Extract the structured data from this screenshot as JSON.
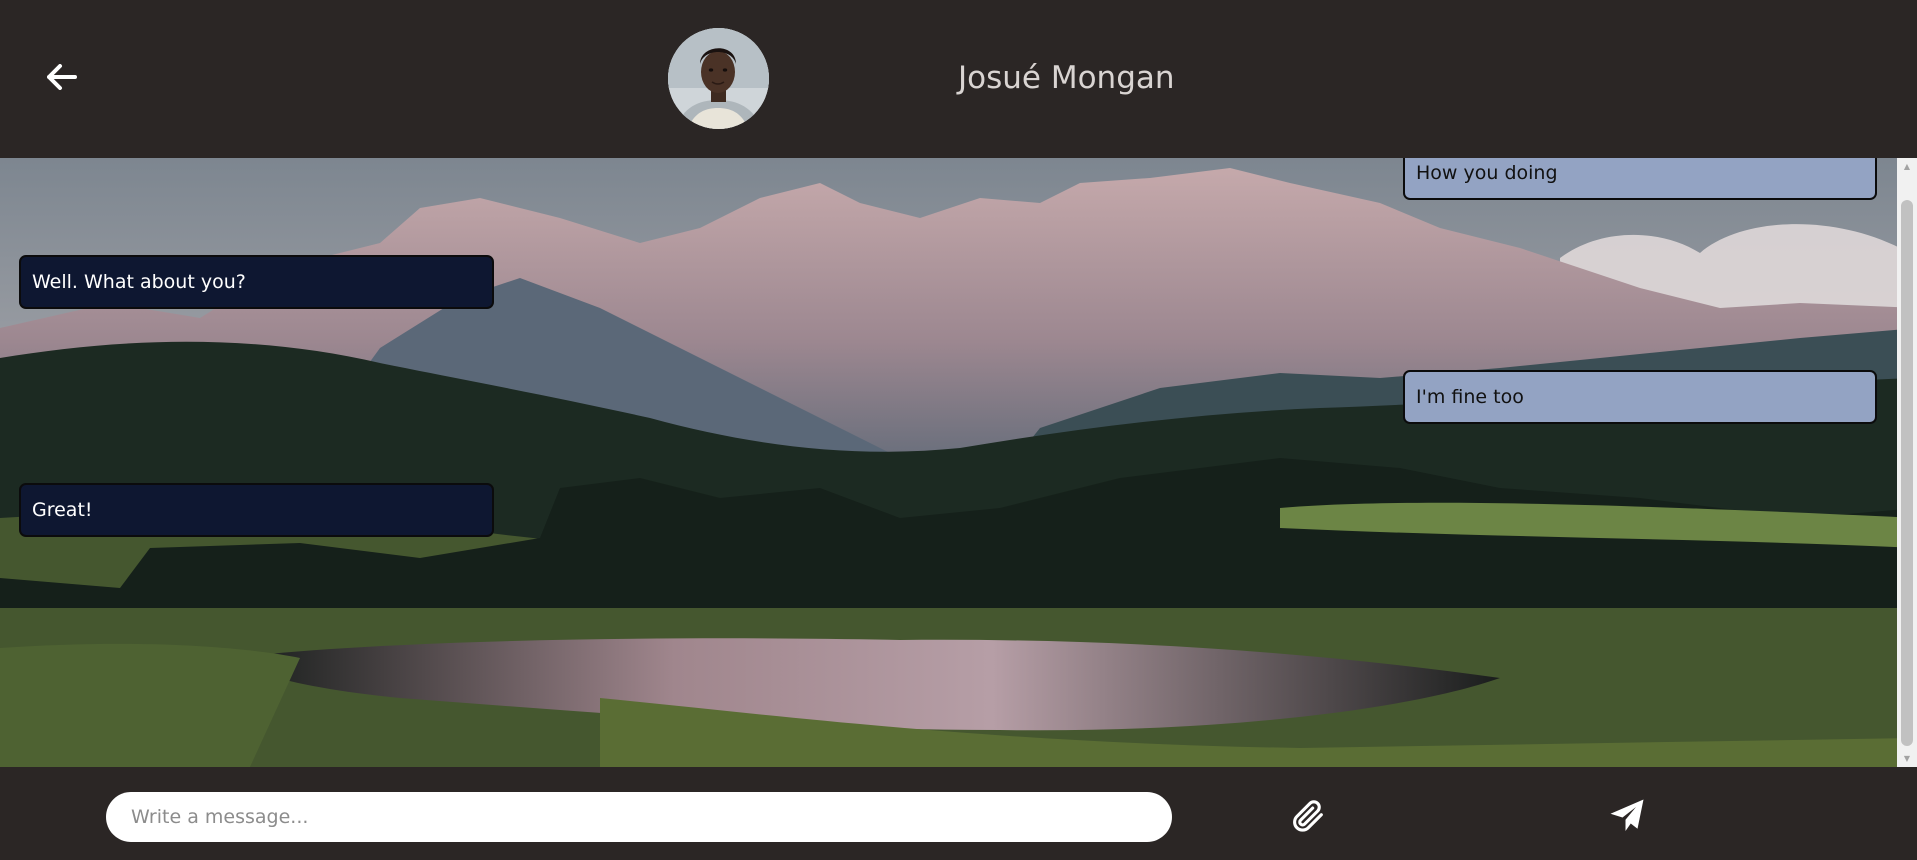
{
  "header": {
    "back_icon": "arrow-left-icon",
    "avatar_icon": "user-photo-avatar",
    "contact_name": "Josué Mongan"
  },
  "chat": {
    "background": "mountain-lake-landscape",
    "messages": [
      {
        "direction": "sent",
        "text": "How you doing"
      },
      {
        "direction": "received",
        "text": "Well. What about you?"
      },
      {
        "direction": "sent",
        "text": "I'm fine too"
      },
      {
        "direction": "received",
        "text": "Great!"
      }
    ]
  },
  "composer": {
    "placeholder": "Write a message...",
    "attach_icon": "paperclip-icon",
    "send_icon": "paper-plane-icon"
  },
  "colors": {
    "header_bg": "#2b2625",
    "received_bubble": "#0e1731",
    "sent_bubble": "#93a3c3",
    "name_text": "#d9d4d2"
  }
}
